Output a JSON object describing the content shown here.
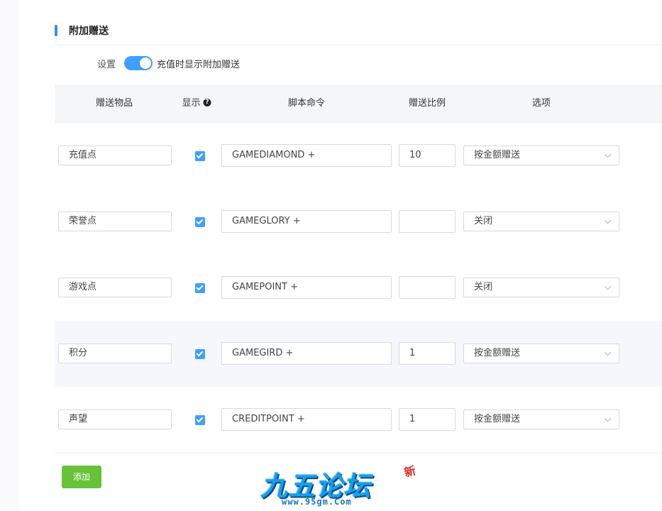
{
  "section": {
    "title": "附加赠送"
  },
  "setting": {
    "label": "设置",
    "switch_on": true,
    "text": "充值时显示附加赠送"
  },
  "columns": [
    "赠送物品",
    "显示",
    "脚本命令",
    "赠送比例",
    "选项"
  ],
  "rows": [
    {
      "item": "充值点",
      "show": true,
      "command": "GAMEDIAMOND +",
      "ratio": "10",
      "option": "按金额赠送"
    },
    {
      "item": "荣誉点",
      "show": true,
      "command": "GAMEGLORY +",
      "ratio": "",
      "option": "关闭"
    },
    {
      "item": "游戏点",
      "show": true,
      "command": "GAMEPOINT +",
      "ratio": "",
      "option": "关闭"
    },
    {
      "item": "积分",
      "show": true,
      "command": "GAMEGIRD +",
      "ratio": "1",
      "option": "按金额赠送"
    },
    {
      "item": "声望",
      "show": true,
      "command": "CREDITPOINT +",
      "ratio": "1",
      "option": "按金额赠送"
    }
  ],
  "add_button": "添加",
  "logo": {
    "text": "九五论坛",
    "url": "www.95gm.Com",
    "badge": "新"
  },
  "colors": {
    "accent": "#409eff",
    "add": "#67c23a",
    "row_highlight": "#f5f7fc"
  }
}
